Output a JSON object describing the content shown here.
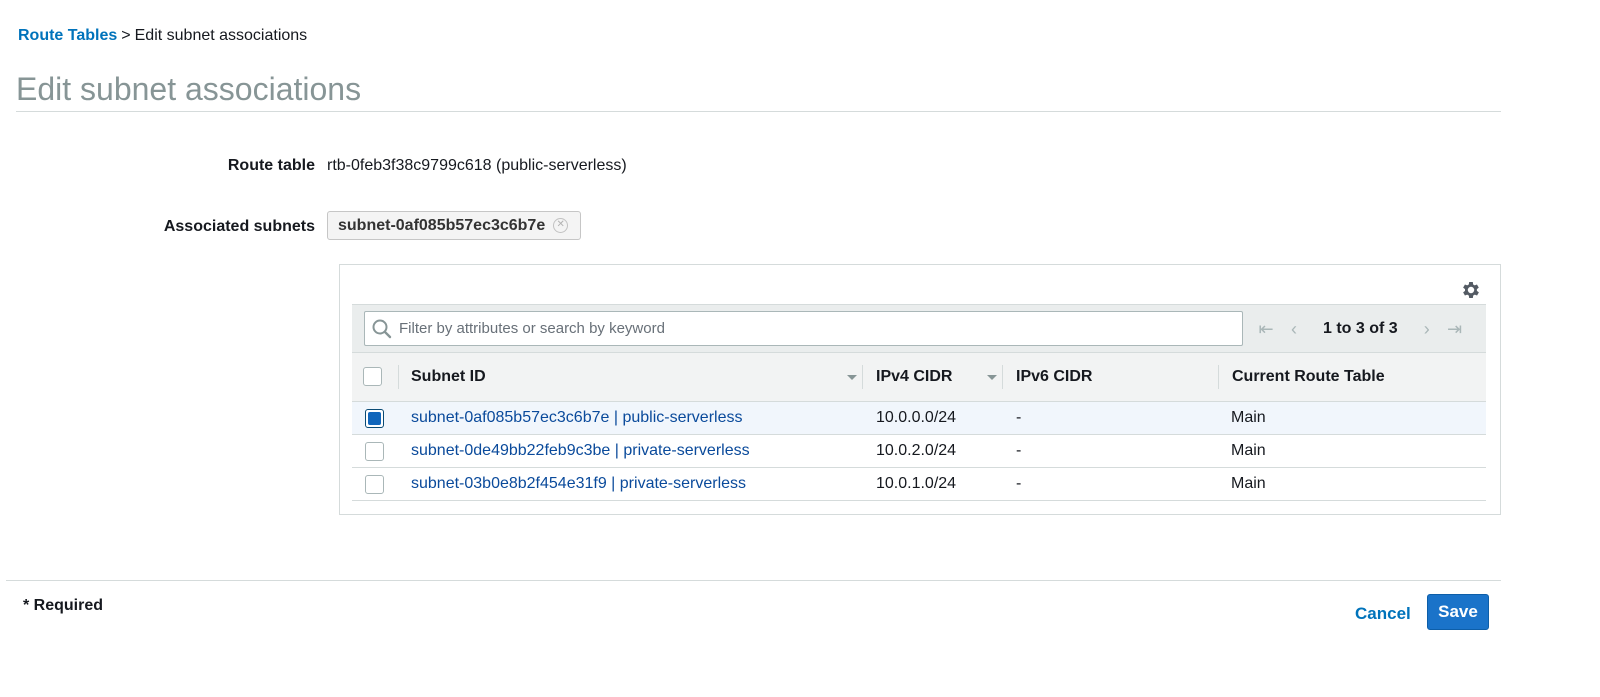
{
  "breadcrumb": {
    "link": "Route Tables",
    "separator": ">",
    "current": "Edit subnet associations"
  },
  "page": {
    "title": "Edit subnet associations"
  },
  "form": {
    "route_table_label": "Route table",
    "route_table_value": "rtb-0feb3f38c9799c618 (public-serverless)",
    "associated_subnets_label": "Associated subnets",
    "associated_token": "subnet-0af085b57ec3c6b7e"
  },
  "table": {
    "search_placeholder": "Filter by attributes or search by keyword",
    "pagination": "1 to 3 of 3",
    "columns": [
      "Subnet ID",
      "IPv4 CIDR",
      "IPv6 CIDR",
      "Current Route Table"
    ],
    "rows": [
      {
        "subnet": "subnet-0af085b57ec3c6b7e | public-serverless",
        "ipv4": "10.0.0.0/24",
        "ipv6": "-",
        "route_table": "Main",
        "checked": true
      },
      {
        "subnet": "subnet-0de49bb22feb9c3be | private-serverless",
        "ipv4": "10.0.2.0/24",
        "ipv6": "-",
        "route_table": "Main",
        "checked": false
      },
      {
        "subnet": "subnet-03b0e8b2f454e31f9 | private-serverless",
        "ipv4": "10.0.1.0/24",
        "ipv6": "-",
        "route_table": "Main",
        "checked": false
      }
    ]
  },
  "footer": {
    "required": "* Required",
    "cancel": "Cancel",
    "save": "Save"
  },
  "colors": {
    "accent": "#0073bb",
    "primary_button": "#1a73c9",
    "selected_row": "#f1f6fc",
    "link": "#0a4a9b"
  },
  "icons": {
    "settings": "gear-icon",
    "search": "search-icon",
    "remove_token": "close-circle-icon"
  }
}
